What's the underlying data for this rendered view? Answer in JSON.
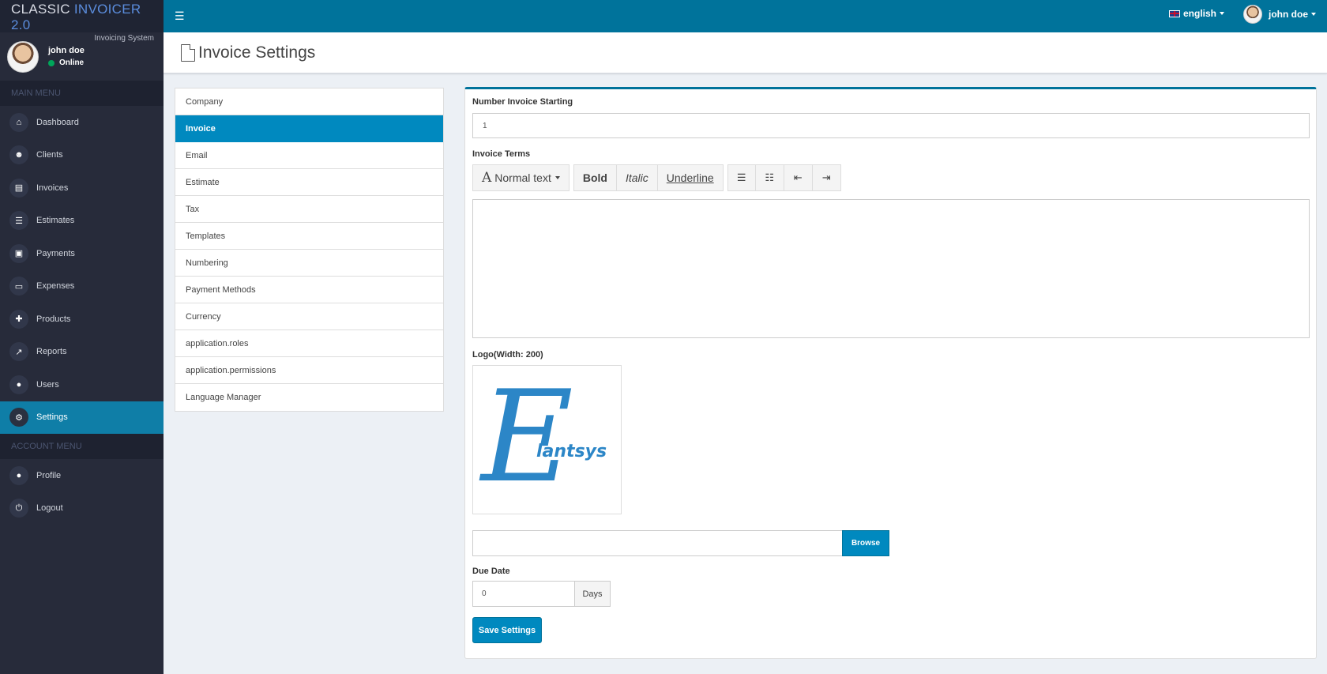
{
  "brand": {
    "title_main": "CLASSIC",
    "title_accent": "INVOICER 2.0",
    "subtitle": "Invoicing System"
  },
  "user": {
    "name": "john doe",
    "status": "Online"
  },
  "menu": {
    "main_header": "MAIN MENU",
    "account_header": "ACCOUNT MENU",
    "main_items": [
      {
        "label": "Dashboard",
        "icon": "home-icon"
      },
      {
        "label": "Clients",
        "icon": "users-icon"
      },
      {
        "label": "Invoices",
        "icon": "file-pdf-icon"
      },
      {
        "label": "Estimates",
        "icon": "list-alt-icon"
      },
      {
        "label": "Payments",
        "icon": "money-icon"
      },
      {
        "label": "Expenses",
        "icon": "credit-card-icon"
      },
      {
        "label": "Products",
        "icon": "puzzle-icon"
      },
      {
        "label": "Reports",
        "icon": "line-chart-icon"
      },
      {
        "label": "Users",
        "icon": "user-icon"
      },
      {
        "label": "Settings",
        "icon": "cogs-icon",
        "active": true
      }
    ],
    "account_items": [
      {
        "label": "Profile",
        "icon": "user-icon"
      },
      {
        "label": "Logout",
        "icon": "power-icon"
      }
    ]
  },
  "topbar": {
    "language": "english",
    "user_name": "john doe"
  },
  "page": {
    "title": "Invoice Settings"
  },
  "settings_nav": [
    "Company",
    "Invoice",
    "Email",
    "Estimate",
    "Tax",
    "Templates",
    "Numbering",
    "Payment Methods",
    "Currency",
    "application.roles",
    "application.permissions",
    "Language Manager"
  ],
  "settings_nav_active": "Invoice",
  "form": {
    "number_label": "Number Invoice Starting",
    "number_value": "1",
    "terms_label": "Invoice Terms",
    "toolbar": {
      "text_style": "Normal text",
      "bold": "Bold",
      "italic": "Italic",
      "underline": "Underline"
    },
    "logo_label": "Logo(Width: 200)",
    "logo_text": "lantsys",
    "logo_letter": "E",
    "browse_label": "Browse",
    "due_label": "Due Date",
    "due_value": "0",
    "due_unit": "Days",
    "save_label": "Save Settings"
  },
  "colors": {
    "topbar": "#00739b",
    "accent": "#0089bf",
    "sidebar": "#272b3a",
    "active_menu": "#0f7ea7"
  }
}
